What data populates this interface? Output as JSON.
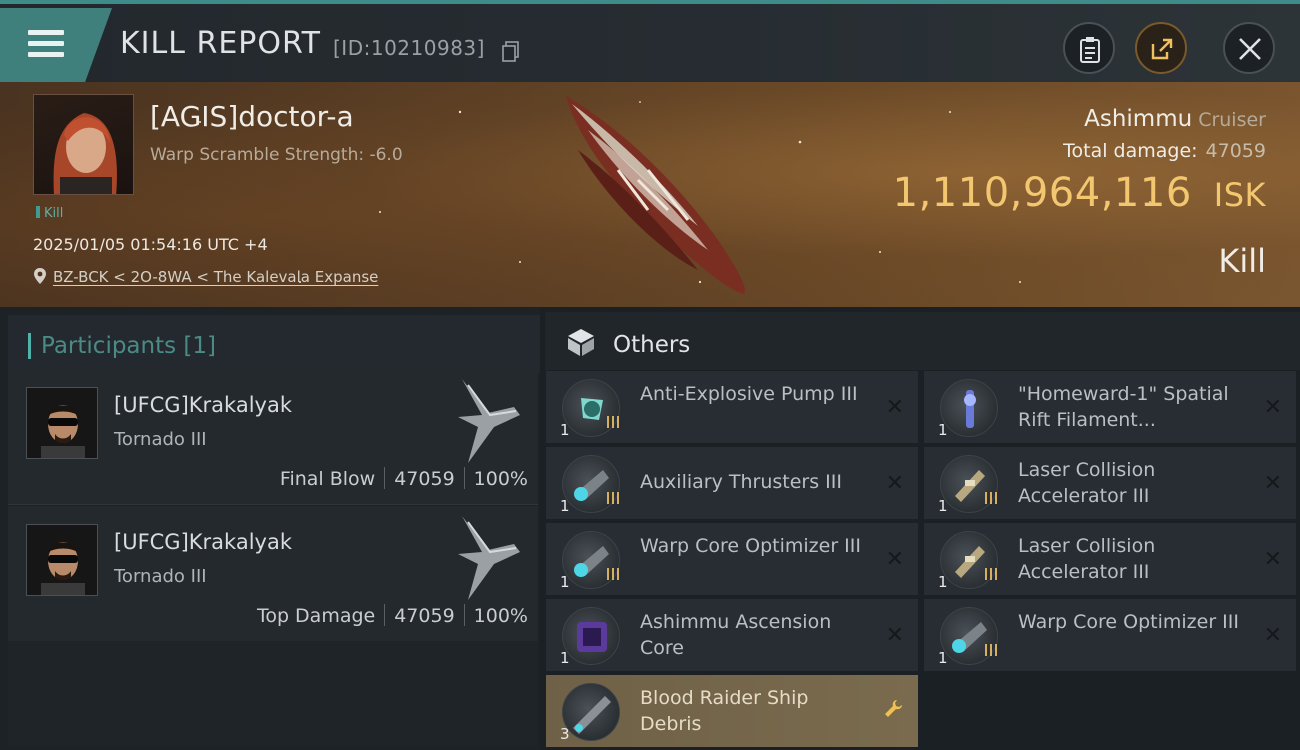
{
  "header": {
    "title": "KILL REPORT",
    "id_text": "[ID:10210983]"
  },
  "victim": {
    "name": "[AGIS]doctor-a",
    "warp_scramble": "Warp Scramble Strength: -6.0",
    "tag": "Kill",
    "datetime": "2025/01/05 01:54:16 UTC +4",
    "location": "BZ-BCK < 2O-8WA < The Kalevala Expanse"
  },
  "ship": {
    "name": "Ashimmu",
    "class": "Cruiser",
    "total_damage_label": "Total damage:",
    "total_damage_value": "47059",
    "isk_value": "1,110,964,116",
    "isk_unit": "ISK",
    "result": "Kill"
  },
  "participants": {
    "title": "Participants",
    "count": "[1]",
    "items": [
      {
        "name": "[UFCG]Krakalyak",
        "ship": "Tornado III",
        "role": "Final Blow",
        "damage": "47059",
        "percent": "100%"
      },
      {
        "name": "[UFCG]Krakalyak",
        "ship": "Tornado III",
        "role": "Top Damage",
        "damage": "47059",
        "percent": "100%"
      }
    ]
  },
  "others": {
    "title": "Others",
    "items": [
      {
        "name": "Anti-Explosive Pump III",
        "qty": "1"
      },
      {
        "name": "\"Homeward-1\" Spatial Rift Filament...",
        "qty": "1"
      },
      {
        "name": "Auxiliary Thrusters III",
        "qty": "1"
      },
      {
        "name": "Laser Collision Accelerator III",
        "qty": "1"
      },
      {
        "name": "Warp Core Optimizer III",
        "qty": "1"
      },
      {
        "name": "Laser Collision Accelerator III",
        "qty": "1"
      },
      {
        "name": "Ashimmu Ascension Core",
        "qty": "1"
      },
      {
        "name": "Warp Core Optimizer III",
        "qty": "1"
      },
      {
        "name": "Blood Raider Ship Debris",
        "qty": "3"
      }
    ]
  },
  "colors": {
    "accent": "#3f7f7c",
    "isk": "#f3c770",
    "highlight": "#7a6b4e"
  }
}
